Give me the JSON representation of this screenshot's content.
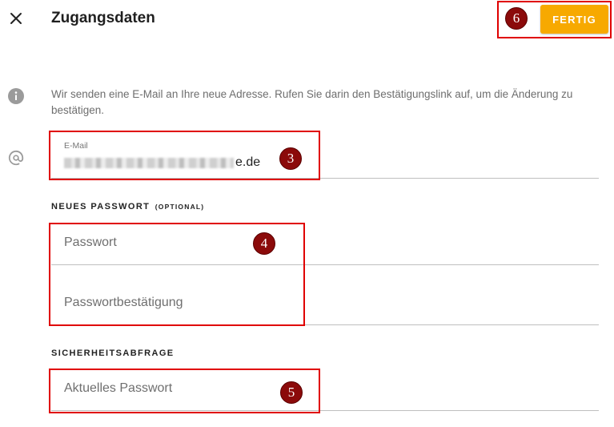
{
  "header": {
    "title": "Zugangsdaten",
    "done_label": "FERTIG"
  },
  "info": {
    "text": "Wir senden eine E-Mail an Ihre neue Adresse. Rufen Sie darin den Bestätigungslink auf, um die Änderung zu bestätigen."
  },
  "email": {
    "label": "E-Mail",
    "value_visible_suffix": "e.de"
  },
  "new_password": {
    "section_title": "NEUES PASSWORT",
    "section_hint": "(OPTIONAL)",
    "password_placeholder": "Passwort",
    "confirm_placeholder": "Passwortbestätigung"
  },
  "security": {
    "section_title": "SICHERHEITSABFRAGE",
    "current_password_placeholder": "Aktuelles Passwort"
  },
  "annotations": {
    "done": "6",
    "email": "3",
    "new_password": "4",
    "current_password": "5"
  },
  "colors": {
    "accent": "#f7a900",
    "annotation_red": "#e00000",
    "badge": "#8b0a0a"
  }
}
